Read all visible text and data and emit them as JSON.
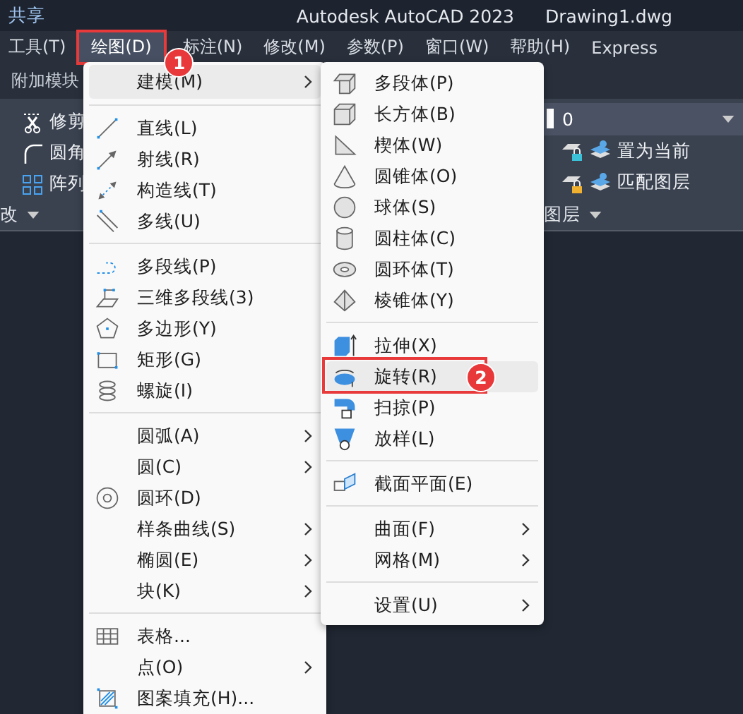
{
  "title_bar": {
    "share": "共享",
    "title": "Autodesk AutoCAD 2023",
    "file": "Drawing1.dwg"
  },
  "menu_bar": [
    {
      "label": "工具(T)",
      "selected": false
    },
    {
      "label": "绘图(D)",
      "selected": true,
      "callout": "1"
    },
    {
      "label": "标注(N)",
      "selected": false
    },
    {
      "label": "修改(M)",
      "selected": false
    },
    {
      "label": "参数(P)",
      "selected": false
    },
    {
      "label": "窗口(W)",
      "selected": false
    },
    {
      "label": "帮助(H)",
      "selected": false
    },
    {
      "label": "Express",
      "selected": false
    }
  ],
  "ribbon_tab": "附加模块",
  "ribbon": {
    "modify_tools": [
      "修剪",
      "圆角",
      "阵列"
    ],
    "modify_title": "改",
    "layer_value": "0",
    "layer_tools": [
      "置为当前",
      "匹配图层"
    ],
    "layer_title": "图层"
  },
  "draw_menu": [
    {
      "kind": "item",
      "label": "建模(M)",
      "submenu": true,
      "selected": true
    },
    {
      "kind": "separator"
    },
    {
      "kind": "item",
      "label": "直线(L)",
      "submenu": false,
      "selected": false
    },
    {
      "kind": "item",
      "label": "射线(R)",
      "submenu": false,
      "selected": false
    },
    {
      "kind": "item",
      "label": "构造线(T)",
      "submenu": false,
      "selected": false
    },
    {
      "kind": "item",
      "label": "多线(U)",
      "submenu": false,
      "selected": false
    },
    {
      "kind": "separator"
    },
    {
      "kind": "item",
      "label": "多段线(P)",
      "submenu": false,
      "selected": false
    },
    {
      "kind": "item",
      "label": "三维多段线(3)",
      "submenu": false,
      "selected": false
    },
    {
      "kind": "item",
      "label": "多边形(Y)",
      "submenu": false,
      "selected": false
    },
    {
      "kind": "item",
      "label": "矩形(G)",
      "submenu": false,
      "selected": false
    },
    {
      "kind": "item",
      "label": "螺旋(I)",
      "submenu": false,
      "selected": false
    },
    {
      "kind": "separator"
    },
    {
      "kind": "item",
      "label": "圆弧(A)",
      "submenu": true,
      "selected": false
    },
    {
      "kind": "item",
      "label": "圆(C)",
      "submenu": true,
      "selected": false
    },
    {
      "kind": "item",
      "label": "圆环(D)",
      "submenu": false,
      "selected": false
    },
    {
      "kind": "item",
      "label": "样条曲线(S)",
      "submenu": true,
      "selected": false
    },
    {
      "kind": "item",
      "label": "椭圆(E)",
      "submenu": true,
      "selected": false
    },
    {
      "kind": "item",
      "label": "块(K)",
      "submenu": true,
      "selected": false
    },
    {
      "kind": "separator"
    },
    {
      "kind": "item",
      "label": "表格...",
      "submenu": false,
      "selected": false
    },
    {
      "kind": "item",
      "label": "点(O)",
      "submenu": true,
      "selected": false
    },
    {
      "kind": "item",
      "label": "图案填充(H)...",
      "submenu": false,
      "selected": false
    }
  ],
  "modeling_submenu": [
    {
      "kind": "item",
      "label": "多段体(P)",
      "submenu": false,
      "selected": false
    },
    {
      "kind": "item",
      "label": "长方体(B)",
      "submenu": false,
      "selected": false
    },
    {
      "kind": "item",
      "label": "楔体(W)",
      "submenu": false,
      "selected": false
    },
    {
      "kind": "item",
      "label": "圆锥体(O)",
      "submenu": false,
      "selected": false
    },
    {
      "kind": "item",
      "label": "球体(S)",
      "submenu": false,
      "selected": false
    },
    {
      "kind": "item",
      "label": "圆柱体(C)",
      "submenu": false,
      "selected": false
    },
    {
      "kind": "item",
      "label": "圆环体(T)",
      "submenu": false,
      "selected": false
    },
    {
      "kind": "item",
      "label": "棱锥体(Y)",
      "submenu": false,
      "selected": false
    },
    {
      "kind": "separator"
    },
    {
      "kind": "item",
      "label": "拉伸(X)",
      "submenu": false,
      "selected": false
    },
    {
      "kind": "item",
      "label": "旋转(R)",
      "submenu": false,
      "selected": true,
      "callout": "2"
    },
    {
      "kind": "item",
      "label": "扫掠(P)",
      "submenu": false,
      "selected": false
    },
    {
      "kind": "item",
      "label": "放样(L)",
      "submenu": false,
      "selected": false
    },
    {
      "kind": "separator"
    },
    {
      "kind": "item",
      "label": "截面平面(E)",
      "submenu": false,
      "selected": false
    },
    {
      "kind": "separator"
    },
    {
      "kind": "item",
      "label": "曲面(F)",
      "submenu": true,
      "selected": false
    },
    {
      "kind": "item",
      "label": "网格(M)",
      "submenu": true,
      "selected": false
    },
    {
      "kind": "separator"
    },
    {
      "kind": "item",
      "label": "设置(U)",
      "submenu": true,
      "selected": false
    }
  ]
}
